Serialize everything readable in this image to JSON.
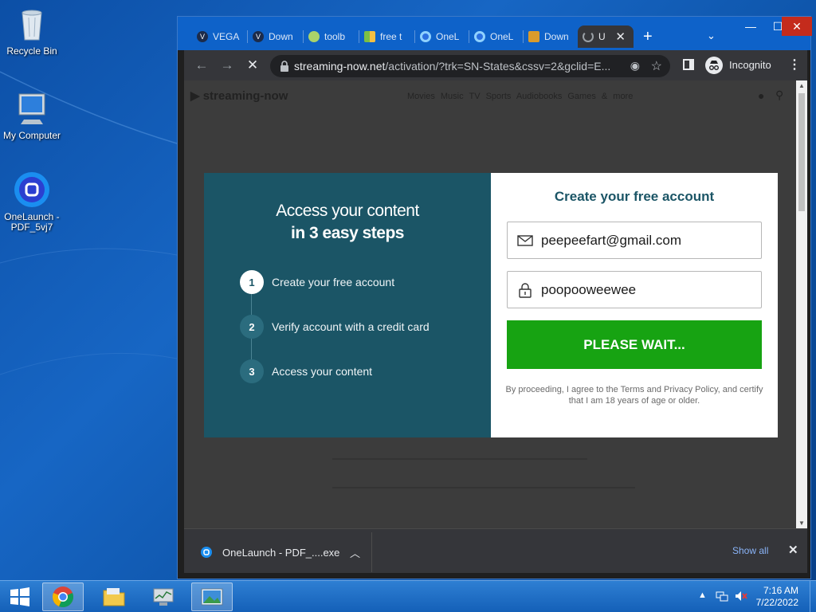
{
  "desktop": {
    "icons": [
      {
        "label": "Recycle Bin"
      },
      {
        "label": "My Computer"
      },
      {
        "label": "OneLaunch - PDF_5vj7"
      }
    ]
  },
  "browser": {
    "tabs": [
      {
        "label": "VEGA",
        "icon": "vega-favicon"
      },
      {
        "label": "Down",
        "icon": "vega-favicon"
      },
      {
        "label": "toolb",
        "icon": "toolbar-favicon"
      },
      {
        "label": "free t",
        "icon": "bars-favicon"
      },
      {
        "label": "OneL",
        "icon": "onelaunch-favicon"
      },
      {
        "label": "OneL",
        "icon": "onelaunch-favicon"
      },
      {
        "label": "Down",
        "icon": "book-favicon"
      },
      {
        "label": "U",
        "icon": "loading-spinner-icon"
      }
    ],
    "new_tab_label": "+",
    "url_host": "streaming-now.net",
    "url_path": "/activation/?trk=SN-States&cssv=2&gclid=E...",
    "incognito_label": "Incognito"
  },
  "site": {
    "logo": "streaming-now",
    "nav": "Movies  Music  TV  Sports  Audiobooks  Games & more"
  },
  "modal": {
    "heading_line1": "Access your content",
    "heading_line2": "in 3 easy steps",
    "steps": [
      {
        "num": "1",
        "label": "Create your free account"
      },
      {
        "num": "2",
        "label": "Verify account with a credit card"
      },
      {
        "num": "3",
        "label": "Access your content"
      }
    ],
    "form_title": "Create your free account",
    "email_value": "peepeefart@gmail.com",
    "password_value": "poopooweewee",
    "submit_label": "PLEASE WAIT...",
    "legal_text": "By proceeding, I agree to the Terms and Privacy Policy, and certify that I am 18 years of age or older."
  },
  "downloads": {
    "file_label": "OneLaunch - PDF_....exe",
    "show_all": "Show all"
  },
  "taskbar": {
    "time": "7:16 AM",
    "date": "7/22/2022"
  },
  "colors": {
    "modal_left": "#1b5566",
    "cta_green": "#17a312",
    "tabstrip": "#0e62c9"
  }
}
